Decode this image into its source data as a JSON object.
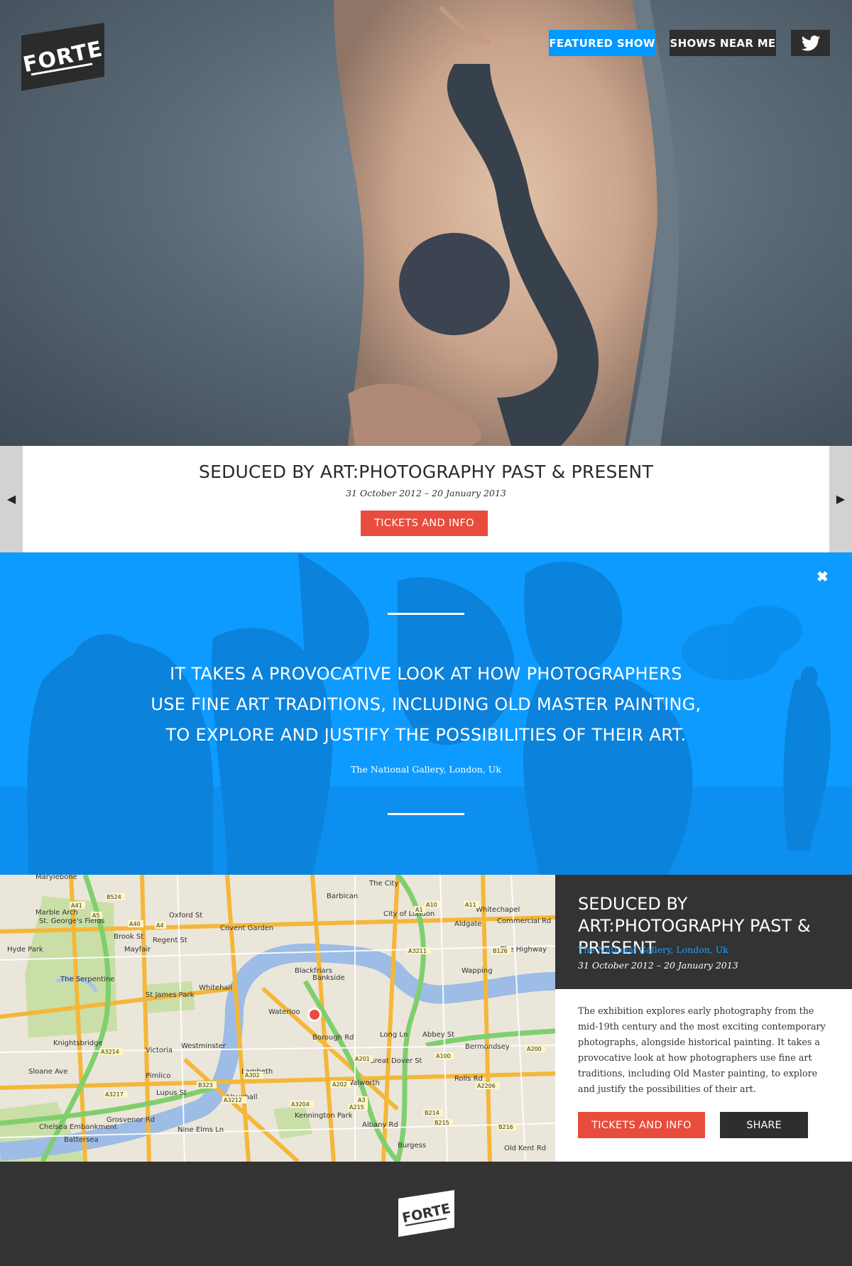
{
  "header": {
    "logo_text": "FORTE",
    "nav": {
      "featured_show": "FEATURED SHOW",
      "shows_near_me": "SHOWS NEAR ME",
      "twitter_icon": "twitter-bird-icon"
    }
  },
  "slider": {
    "prev_icon": "triangle-left-icon",
    "next_icon": "triangle-right-icon",
    "title": "SEDUCED BY ART:PHOTOGRAPHY PAST & PRESENT",
    "dates": "31 October 2012 – 20 January 2013",
    "cta": "TICKETS AND INFO"
  },
  "quote": {
    "close_icon": "close-x-icon",
    "lines": [
      "IT TAKES A PROVOCATIVE LOOK AT HOW PHOTOGRAPHERS",
      "USE FINE ART TRADITIONS, INCLUDING OLD MASTER PAINTING,",
      "TO EXPLORE AND JUSTIFY THE POSSIBILITIES OF THEIR ART."
    ],
    "venue": "The National Gallery, London, Uk"
  },
  "map": {
    "labels": [
      "Marylebone",
      "Barbican",
      "The City",
      "Whitechapel",
      "Marble Arch",
      "St. George's Fields",
      "City of London",
      "Aldgate",
      "Commercial Rd",
      "Covent Garden",
      "Mayfair",
      "Hyde Park",
      "The Highway",
      "Blackfriars",
      "Bankside",
      "Wapping",
      "Whitehall",
      "St James Park",
      "Waterloo",
      "Knightsbridge",
      "Victoria",
      "Westminster",
      "Bermondsey",
      "Lambeth",
      "Pimlico",
      "Vauxhall",
      "Walworth",
      "Kennington Park",
      "Battersea",
      "Burgess",
      "Chelsea Embankment",
      "Grosvenor Rd",
      "Borough Rd",
      "Great Dover St",
      "Long Ln",
      "Abbey St",
      "Rolls Rd",
      "Oxford St",
      "Brook St",
      "Regent St",
      "The Serpentine",
      "Sloane Ave",
      "Lupus St",
      "Nine Elms Ln",
      "Albany Rd",
      "Old Kent Rd"
    ],
    "roads": [
      "A40",
      "A4",
      "A41",
      "A5",
      "A1",
      "A10",
      "A11",
      "A3211",
      "A3212",
      "A302",
      "A3214",
      "A3217",
      "A3204",
      "A202",
      "A201",
      "A200",
      "A2206",
      "A215",
      "A100",
      "A3",
      "B126",
      "B214",
      "B215",
      "B216",
      "B323",
      "B524"
    ],
    "marker_icon": "map-pin-icon"
  },
  "info": {
    "title": "SEDUCED BY ART:PHOTOGRAPHY PAST & PRESENT",
    "venue": "The National Gallery, London, Uk",
    "dates": "31 October 2012 – 20 January 2013",
    "description": "The exhibition explores early photography from the mid-19th century and the most exciting contemporary photographs, alongside historical painting. It takes a provocative look at how photographers use fine art traditions, including Old Master painting, to explore and justify the possibilities of their art.",
    "tickets": "TICKETS AND INFO",
    "share": "SHARE"
  },
  "footer": {
    "logo_text": "FORTE"
  },
  "colors": {
    "accent_blue": "#0099ff",
    "accent_red": "#e74c3c",
    "dark": "#333333"
  }
}
